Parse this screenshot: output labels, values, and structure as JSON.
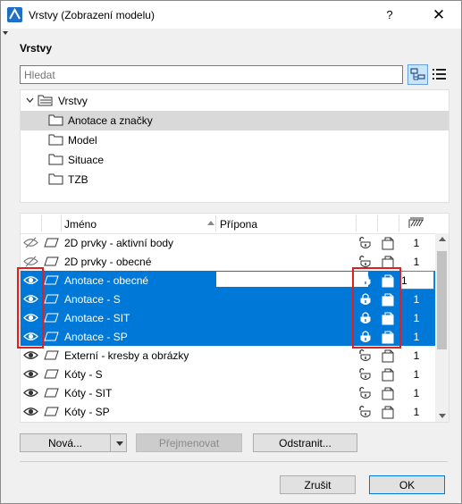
{
  "window": {
    "title": "Vrstvy (Zobrazení modelu)",
    "help_glyph": "?",
    "close_glyph": "✕"
  },
  "section_title": "Vrstvy",
  "search": {
    "value": "",
    "placeholder": "Hledat"
  },
  "tree": {
    "root_label": "Vrstvy",
    "items": [
      {
        "label": "Anotace a značky",
        "selected": true
      },
      {
        "label": "Model",
        "selected": false
      },
      {
        "label": "Situace",
        "selected": false
      },
      {
        "label": "TZB",
        "selected": false
      }
    ]
  },
  "layers": {
    "columns": {
      "name": "Jméno",
      "extension": "Přípona"
    },
    "rows": [
      {
        "name": "2D prvky - aktivní body",
        "visible": false,
        "selected": false,
        "locked": false,
        "num": "1"
      },
      {
        "name": "2D prvky - obecné",
        "visible": false,
        "selected": false,
        "locked": false,
        "num": "1"
      },
      {
        "name": "Anotace - obecné",
        "visible": true,
        "selected": true,
        "locked": true,
        "num": "1"
      },
      {
        "name": "Anotace - S",
        "visible": true,
        "selected": true,
        "locked": true,
        "num": "1"
      },
      {
        "name": "Anotace - SIT",
        "visible": true,
        "selected": true,
        "locked": true,
        "num": "1"
      },
      {
        "name": "Anotace - SP",
        "visible": true,
        "selected": true,
        "locked": true,
        "num": "1"
      },
      {
        "name": "Externí - kresby a obrázky",
        "visible": true,
        "selected": false,
        "locked": false,
        "num": "1"
      },
      {
        "name": "Kóty - S",
        "visible": true,
        "selected": false,
        "locked": false,
        "num": "1"
      },
      {
        "name": "Kóty - SIT",
        "visible": true,
        "selected": false,
        "locked": false,
        "num": "1"
      },
      {
        "name": "Kóty - SP",
        "visible": true,
        "selected": false,
        "locked": false,
        "num": "1"
      }
    ]
  },
  "buttons": {
    "new": "Nová...",
    "rename": "Přejmenovat",
    "delete": "Odstranit...",
    "cancel": "Zrušit",
    "ok": "OK"
  },
  "colors": {
    "selection": "#0078d7",
    "highlight_frame": "#e02020"
  }
}
